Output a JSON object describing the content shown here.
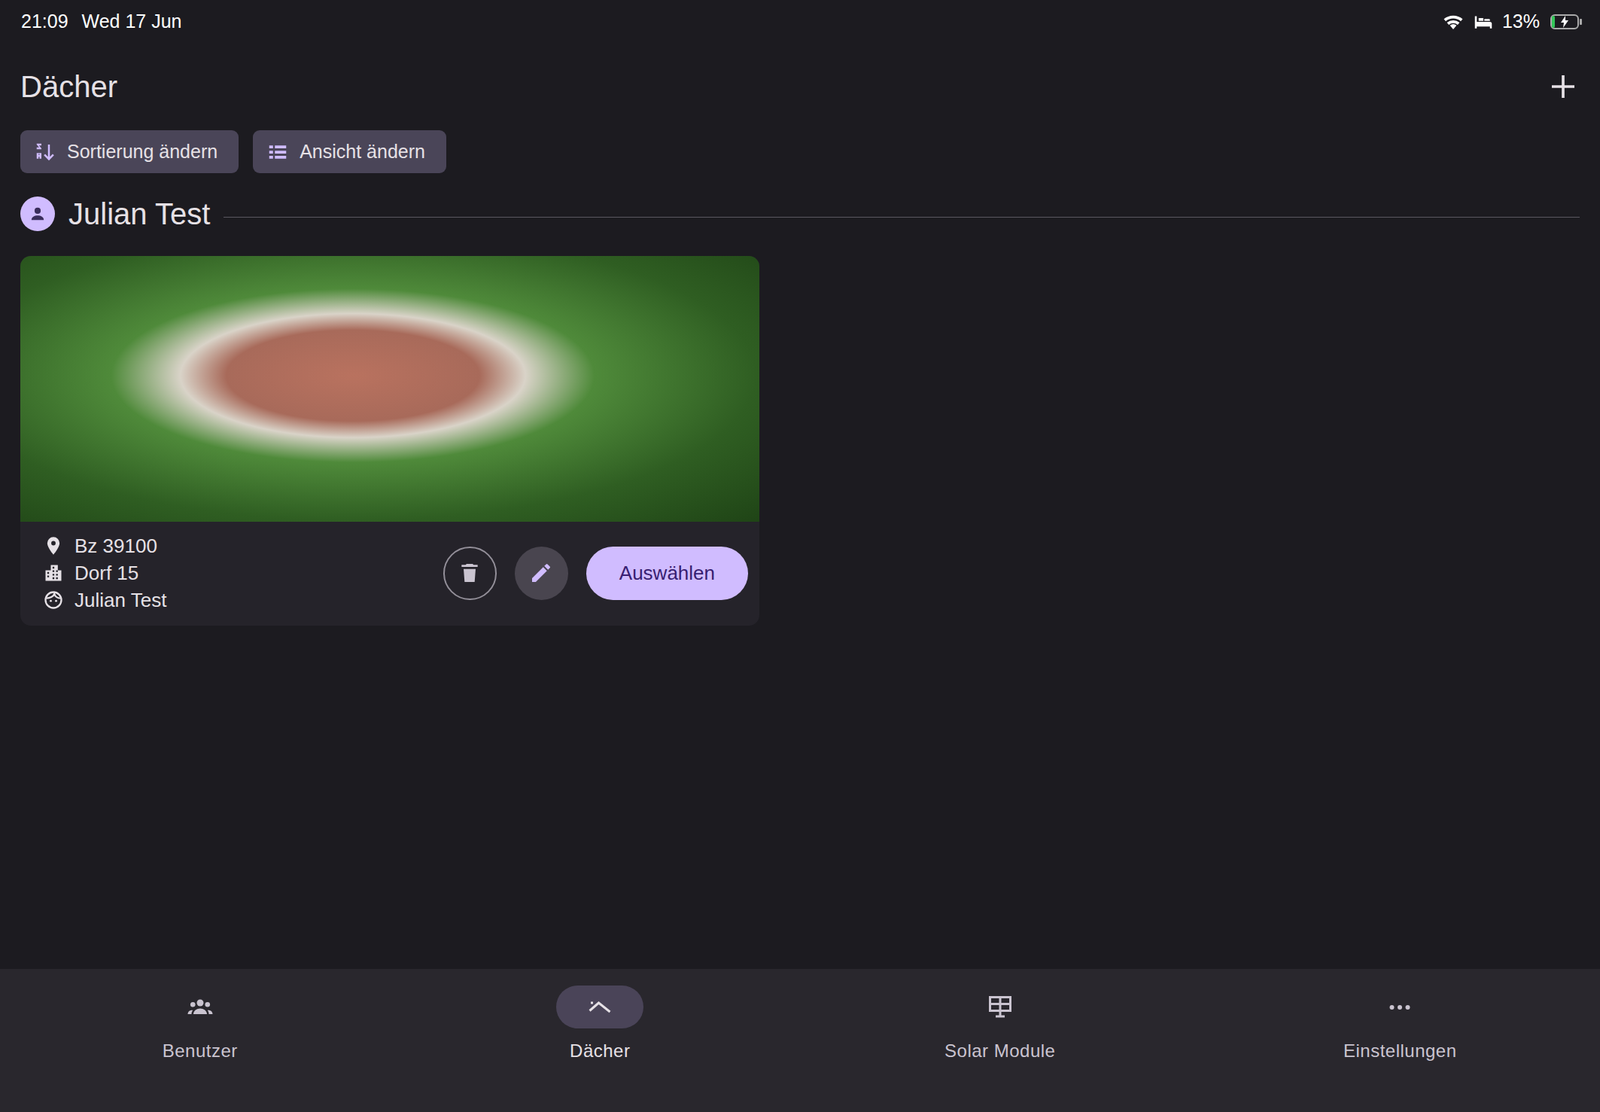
{
  "status_bar": {
    "time": "21:09",
    "date": "Wed 17 Jun",
    "battery": "13%",
    "battery_level": 0.13,
    "charging": true
  },
  "header": {
    "title": "Dächer"
  },
  "toolbar": [
    {
      "label": "Sortierung ändern"
    },
    {
      "label": "Ansicht ändern"
    }
  ],
  "groups": [
    {
      "name": "Julian Test",
      "roofs": [
        {
          "location": "Bz 39100",
          "address": "Dorf 15",
          "owner": "Julian Test",
          "action": "Auswählen"
        }
      ]
    }
  ],
  "nav": [
    {
      "label": "Benutzer",
      "selected": false
    },
    {
      "label": "Dächer",
      "selected": true
    },
    {
      "label": "Solar Module",
      "selected": false
    },
    {
      "label": "Einstellungen",
      "selected": false
    }
  ]
}
